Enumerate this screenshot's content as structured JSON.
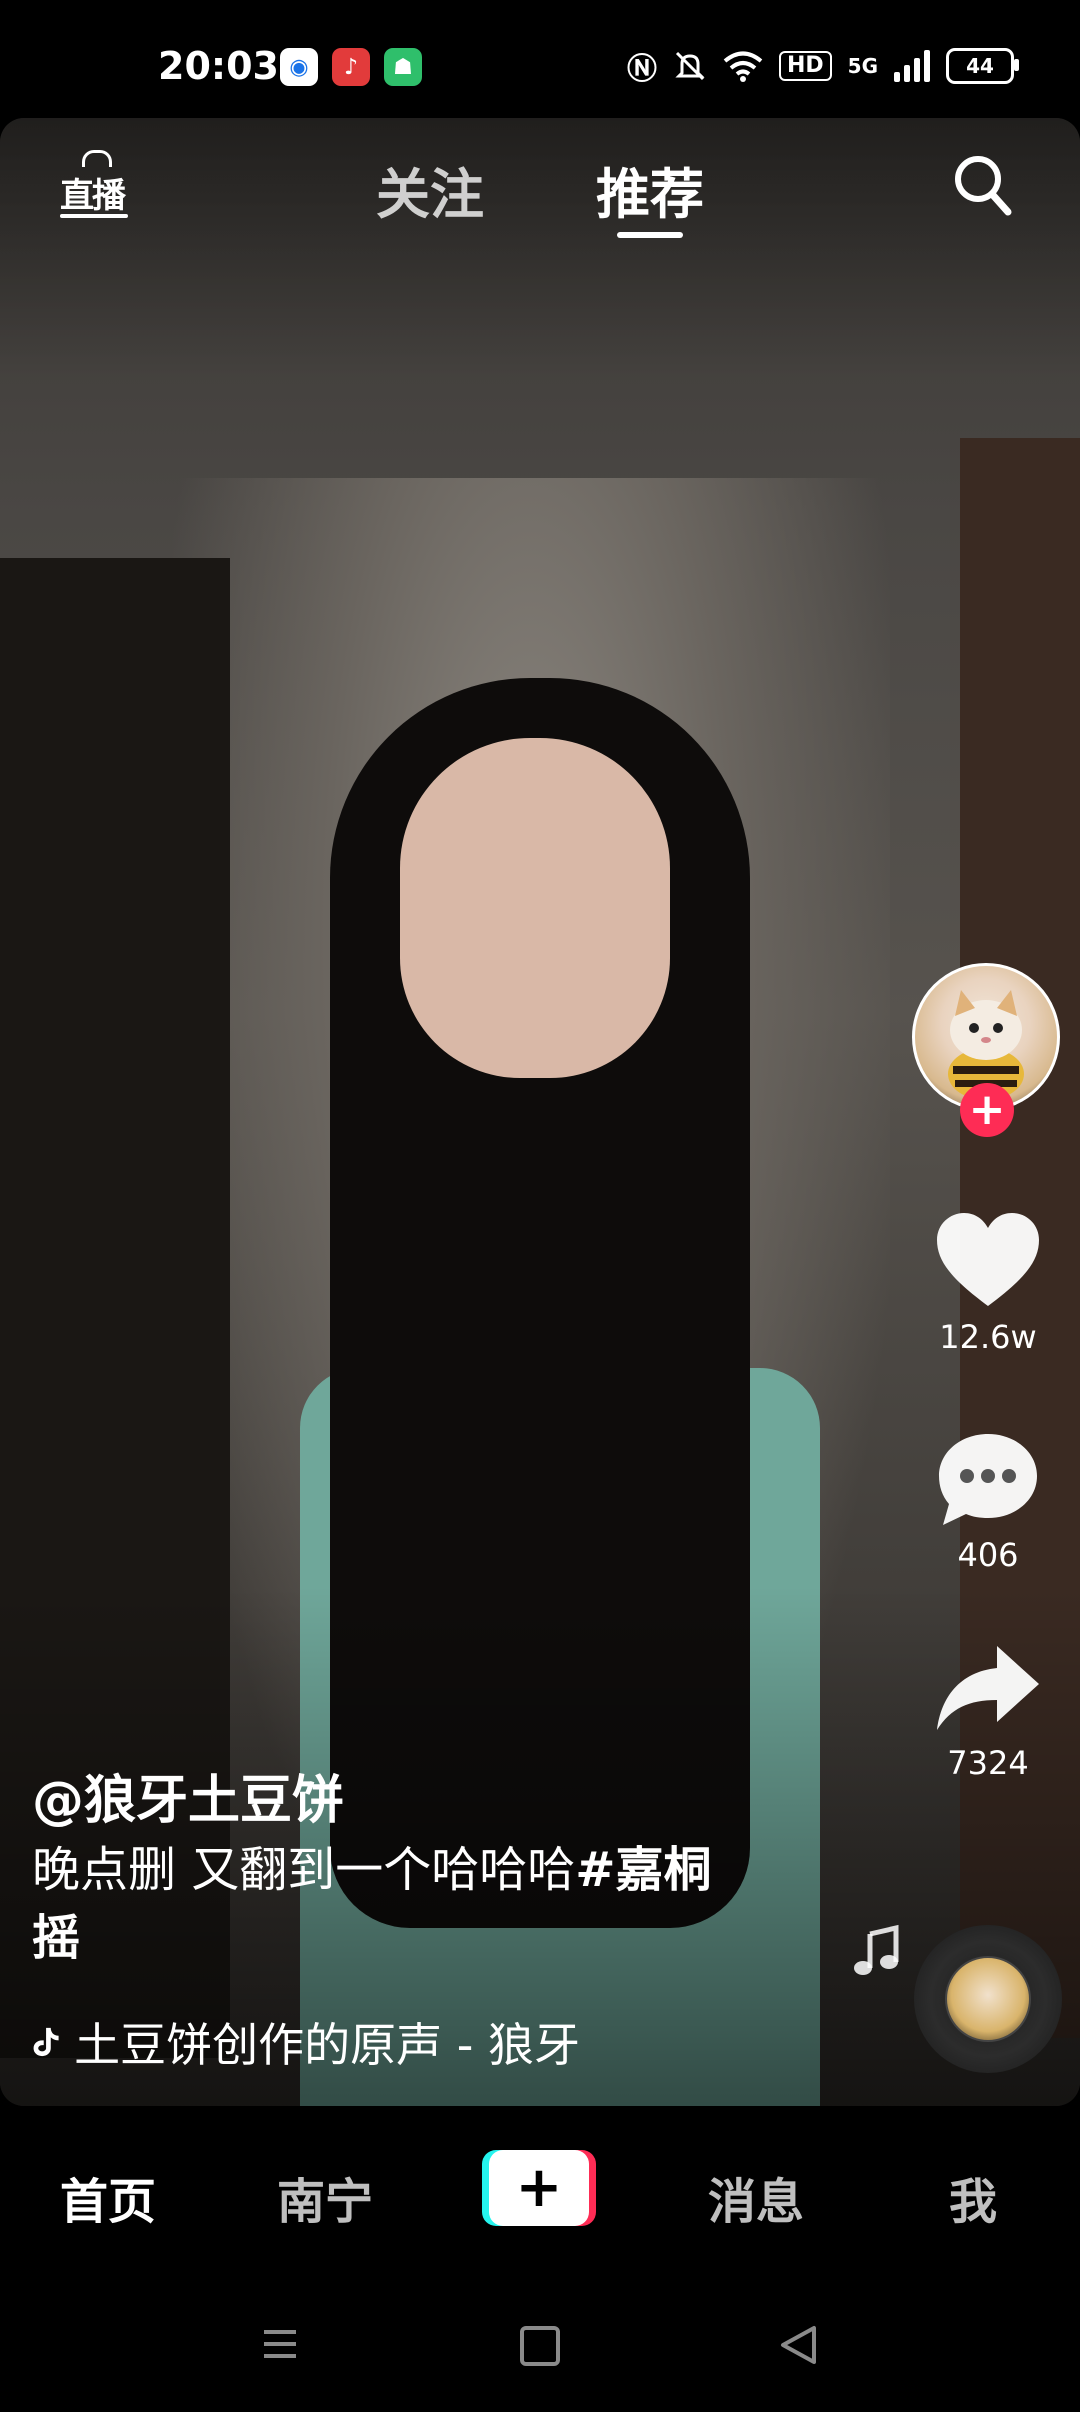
{
  "status_bar": {
    "time": "20:03",
    "hd_label": "HD",
    "network_label": "5G",
    "battery_level": "44"
  },
  "top_nav": {
    "live_label": "直播",
    "tabs": [
      {
        "label": "关注",
        "active": false
      },
      {
        "label": "推荐",
        "active": true
      }
    ]
  },
  "video": {
    "author": "@狼牙土豆饼",
    "description_text": "晚点删 又翻到一个哈哈哈",
    "hashtag": "#嘉桐摇",
    "sound": "土豆饼创作的原声 - 狼牙"
  },
  "actions": {
    "follow_symbol": "+",
    "likes": "12.6w",
    "comments": "406",
    "shares": "7324"
  },
  "bottom_nav": {
    "home": "首页",
    "city": "南宁",
    "create": "+",
    "messages": "消息",
    "me": "我"
  },
  "colors": {
    "accent_red": "#fe2c55",
    "accent_cyan": "#25f4ee"
  }
}
